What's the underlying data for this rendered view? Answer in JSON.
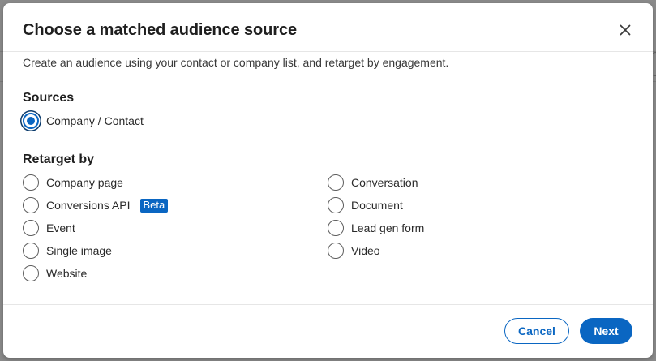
{
  "modal": {
    "title": "Choose a matched audience source",
    "description": "Create an audience using your contact or company list, and retarget by engagement.",
    "close_icon": "close-icon"
  },
  "sources": {
    "heading": "Sources",
    "options": [
      {
        "label": "Company / Contact",
        "selected": true
      }
    ]
  },
  "retarget": {
    "heading": "Retarget by",
    "left_options": [
      {
        "label": "Company page",
        "selected": false
      },
      {
        "label": "Conversions API",
        "selected": false,
        "badge": "Beta"
      },
      {
        "label": "Event",
        "selected": false
      },
      {
        "label": "Single image",
        "selected": false
      },
      {
        "label": "Website",
        "selected": false
      }
    ],
    "right_options": [
      {
        "label": "Conversation",
        "selected": false
      },
      {
        "label": "Document",
        "selected": false
      },
      {
        "label": "Lead gen form",
        "selected": false
      },
      {
        "label": "Video",
        "selected": false
      }
    ]
  },
  "footer": {
    "cancel_label": "Cancel",
    "next_label": "Next"
  },
  "colors": {
    "accent": "#0a66c2",
    "text": "#1f1f1f",
    "backdrop": "#8a8a8a"
  }
}
